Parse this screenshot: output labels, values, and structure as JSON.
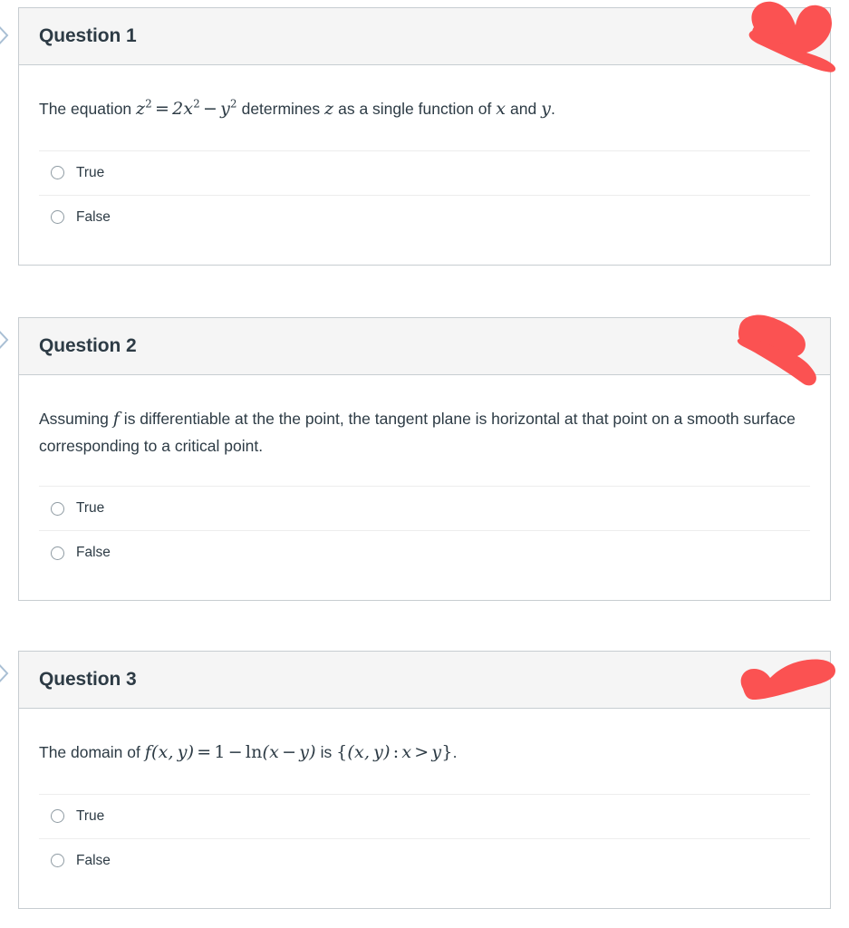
{
  "page": {
    "background_color": "#ffffff",
    "card_border_color": "#c7cdd1",
    "header_background_color": "#f5f5f5",
    "text_color": "#2d3b45",
    "annotation_color": "#fb5252",
    "chevron_color": "#a9bfd4"
  },
  "questions": [
    {
      "header": "Question 1",
      "prompt_parts": {
        "lead": "The equation ",
        "math": "z² = 2x² − y²",
        "mid": " determines ",
        "var1": "z",
        "tail": " as a single function of ",
        "var2": "x",
        "conj": " and ",
        "var3": "y",
        "end": "."
      },
      "prompt_plain": "The equation z² = 2x² − y² determines z as a single function of x and y.",
      "answers": [
        {
          "label": "True",
          "selected": false
        },
        {
          "label": "False",
          "selected": false
        }
      ]
    },
    {
      "header": "Question 2",
      "prompt_parts": {
        "lead": "Assuming ",
        "var1": "f",
        "tail": " is differentiable at the the point, the tangent plane is horizontal at that point on a smooth surface corresponding to a critical point."
      },
      "prompt_plain": "Assuming f is differentiable at the the point, the tangent plane is horizontal at that point on a smooth surface corresponding to a critical point.",
      "answers": [
        {
          "label": "True",
          "selected": false
        },
        {
          "label": "False",
          "selected": false
        }
      ]
    },
    {
      "header": "Question 3",
      "prompt_parts": {
        "lead": "The domain of ",
        "math1": "f(x, y) = 1 − ln(x − y)",
        "mid": " is ",
        "math2": "{(x, y) : x > y}",
        "end": "."
      },
      "prompt_plain": "The domain of f(x, y) = 1 − ln(x − y) is {(x, y) : x > y}.",
      "answers": [
        {
          "label": "True",
          "selected": false
        },
        {
          "label": "False",
          "selected": false
        }
      ]
    }
  ],
  "icons": {
    "radio": "radio-unselected-icon",
    "chevron": "chevron-right-icon",
    "scribble": "red-marker-annotation"
  }
}
